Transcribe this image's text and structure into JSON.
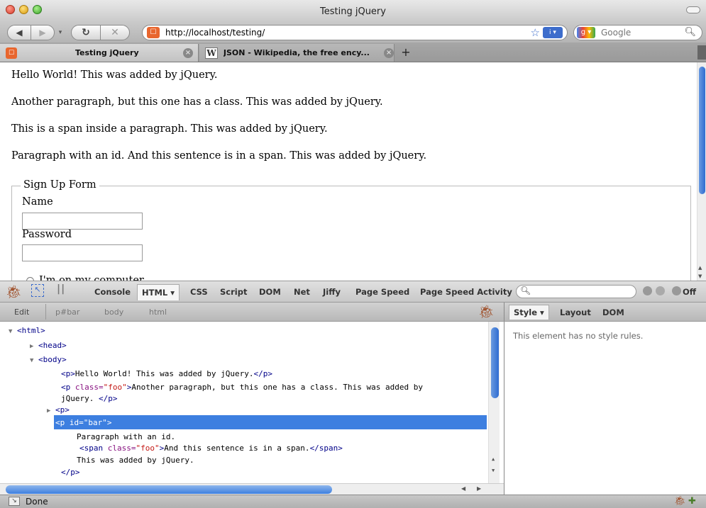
{
  "window": {
    "title": "Testing jQuery"
  },
  "nav": {
    "url": "http://localhost/testing/",
    "search_placeholder": "Google"
  },
  "tabs": [
    {
      "label": "Testing jQuery"
    },
    {
      "label": "JSON - Wikipedia, the free ency..."
    }
  ],
  "page": {
    "paragraphs": [
      "Hello World! This was added by jQuery.",
      "Another paragraph, but this one has a class. This was added by jQuery.",
      "This is a span inside a paragraph. This was added by jQuery.",
      "Paragraph with an id. And this sentence is in a span. This was added by jQuery."
    ],
    "form": {
      "legend": "Sign Up Form",
      "name_label": "Name",
      "password_label": "Password",
      "radio_label": "I'm on my computer"
    }
  },
  "firebug": {
    "tabs": [
      "Console",
      "HTML ▾",
      "CSS",
      "Script",
      "DOM",
      "Net",
      "Jiffy",
      "Page Speed",
      "Page Speed Activity"
    ],
    "off_label": "Off",
    "breadcrumbs": [
      "Edit",
      "p#bar",
      "body",
      "html"
    ],
    "side_tabs": [
      "Style ▾",
      "Layout",
      "DOM"
    ],
    "side_message": "This element has no style rules.",
    "tree": {
      "html_open": "<html>",
      "head": "<head>",
      "body_open": "<body>",
      "p1_open": "<p>",
      "p1_text": "Hello World! This was added by jQuery.",
      "p_close": "</p>",
      "p2_open_tag": "<p",
      "p2_attr": "class=",
      "p2_val": "\"foo\"",
      "p2_gt": ">",
      "p2_text": "Another paragraph, but this one has a class. This was added by",
      "p2_text2": "jQuery.",
      "p3": "<p>",
      "bar_open_tag": "<p",
      "bar_attr": "id=",
      "bar_val": "\"bar\"",
      "bar_gt": ">",
      "bar_text1": "Paragraph with an id.",
      "span_open_tag": "<span",
      "span_attr": "class=",
      "span_val": "\"foo\"",
      "span_gt": ">",
      "span_text": "And this sentence is in a span.",
      "span_close": "</span>",
      "bar_text2": "This was added by jQuery.",
      "bar_close": "</p>"
    }
  },
  "status": {
    "text": "Done"
  }
}
